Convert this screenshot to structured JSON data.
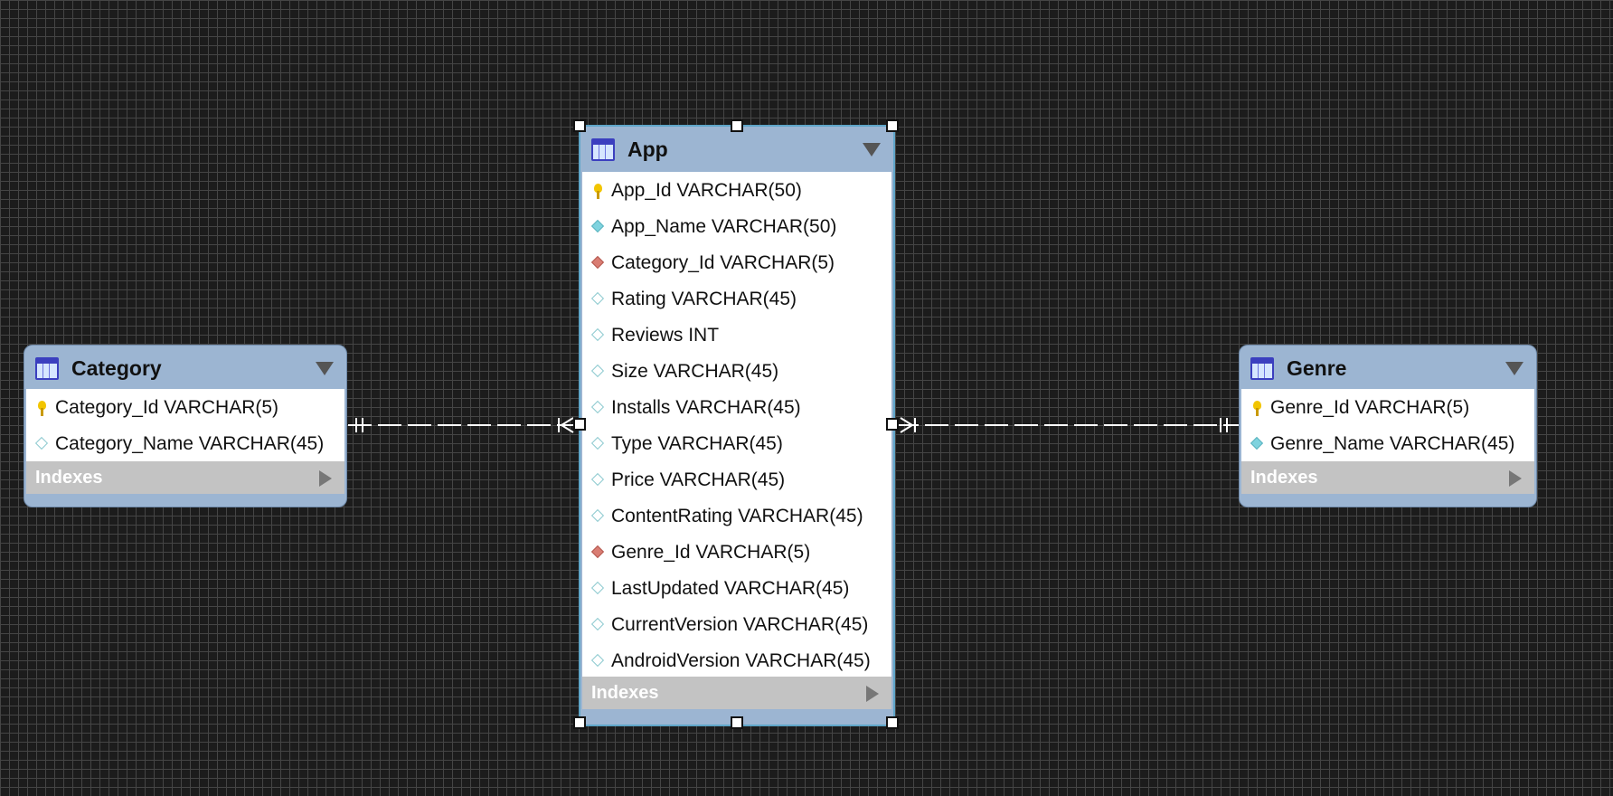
{
  "tables": {
    "category": {
      "name": "Category",
      "columns": [
        {
          "text": "Category_Id VARCHAR(5)",
          "icon": "primary-key-icon"
        },
        {
          "text": "Category_Name VARCHAR(45)",
          "icon": "column-icon"
        }
      ],
      "indexes_label": "Indexes"
    },
    "app": {
      "name": "App",
      "columns": [
        {
          "text": "App_Id VARCHAR(50)",
          "icon": "primary-key-icon"
        },
        {
          "text": "App_Name VARCHAR(50)",
          "icon": "not-null-column-icon"
        },
        {
          "text": "Category_Id VARCHAR(5)",
          "icon": "foreign-key-icon"
        },
        {
          "text": "Rating VARCHAR(45)",
          "icon": "column-icon"
        },
        {
          "text": "Reviews INT",
          "icon": "column-icon"
        },
        {
          "text": "Size VARCHAR(45)",
          "icon": "column-icon"
        },
        {
          "text": "Installs VARCHAR(45)",
          "icon": "column-icon"
        },
        {
          "text": "Type VARCHAR(45)",
          "icon": "column-icon"
        },
        {
          "text": "Price VARCHAR(45)",
          "icon": "column-icon"
        },
        {
          "text": "ContentRating VARCHAR(45)",
          "icon": "column-icon"
        },
        {
          "text": "Genre_Id VARCHAR(5)",
          "icon": "foreign-key-icon"
        },
        {
          "text": "LastUpdated VARCHAR(45)",
          "icon": "column-icon"
        },
        {
          "text": "CurrentVersion VARCHAR(45)",
          "icon": "column-icon"
        },
        {
          "text": "AndroidVersion VARCHAR(45)",
          "icon": "column-icon"
        }
      ],
      "indexes_label": "Indexes"
    },
    "genre": {
      "name": "Genre",
      "columns": [
        {
          "text": "Genre_Id VARCHAR(5)",
          "icon": "primary-key-icon"
        },
        {
          "text": "Genre_Name VARCHAR(45)",
          "icon": "not-null-column-icon"
        }
      ],
      "indexes_label": "Indexes"
    }
  },
  "relationships": [
    {
      "from": "Category",
      "to": "App",
      "type": "one-to-many",
      "style": "dashed"
    },
    {
      "from": "Genre",
      "to": "App",
      "type": "one-to-many",
      "style": "dashed"
    }
  ],
  "colors": {
    "table_header": "#9cb5d2",
    "indexes_bar": "#c3c3c3",
    "foreign_key": "#d97d73",
    "primary_key": "#f2c500",
    "column": "#8cc9cf"
  }
}
